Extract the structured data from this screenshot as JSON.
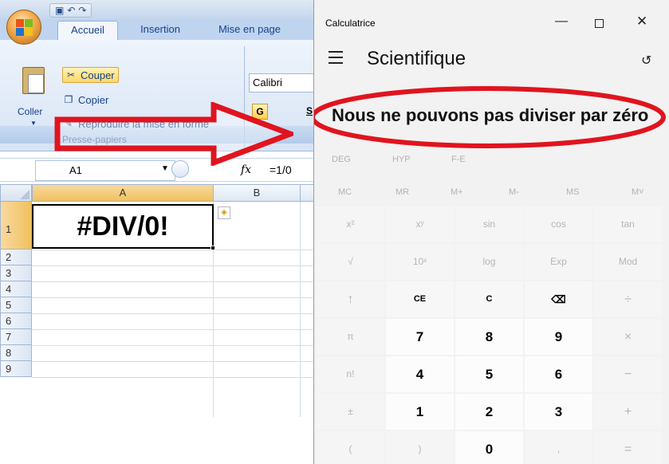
{
  "excel": {
    "tabs": [
      "Accueil",
      "Insertion",
      "Mise en page"
    ],
    "clipboard": {
      "paste": "Coller",
      "cut": "Couper",
      "copy": "Copier",
      "format_painter": "Reproduire la mise en forme",
      "group_label": "Presse-papiers"
    },
    "font_name": "Calibri",
    "bold_label": "G",
    "underline_label": "S",
    "name_box": "A1",
    "fx": "fx",
    "formula": "=1/0",
    "columns": [
      "A",
      "B"
    ],
    "rows": [
      "1",
      "2",
      "3",
      "4",
      "5",
      "6",
      "7",
      "8",
      "9"
    ],
    "cell_a1": "#DIV/0!"
  },
  "calculator": {
    "title": "Calculatrice",
    "mode": "Scientifique",
    "display": "Nous ne pouvons pas diviser par zéro",
    "modes": [
      "DEG",
      "HYP",
      "F-E"
    ],
    "memory": [
      "MC",
      "MR",
      "M+",
      "M-",
      "MS",
      "M˅"
    ],
    "keys": [
      [
        "x²",
        "xʸ",
        "sin",
        "cos",
        "tan"
      ],
      [
        "√",
        "10ˣ",
        "log",
        "Exp",
        "Mod"
      ],
      [
        "↑",
        "CE",
        "C",
        "⌫",
        "÷"
      ],
      [
        "π",
        "7",
        "8",
        "9",
        "×"
      ],
      [
        "n!",
        "4",
        "5",
        "6",
        "−"
      ],
      [
        "±",
        "1",
        "2",
        "3",
        "+"
      ],
      [
        "(",
        ")",
        "0",
        ",",
        "="
      ]
    ],
    "window_controls": {
      "minimize": "—",
      "maximize": "",
      "close": "✕"
    },
    "history_icon": "↺"
  },
  "annotations": {
    "arrow_color": "#e0141e",
    "ellipse_color": "#e0141e"
  }
}
